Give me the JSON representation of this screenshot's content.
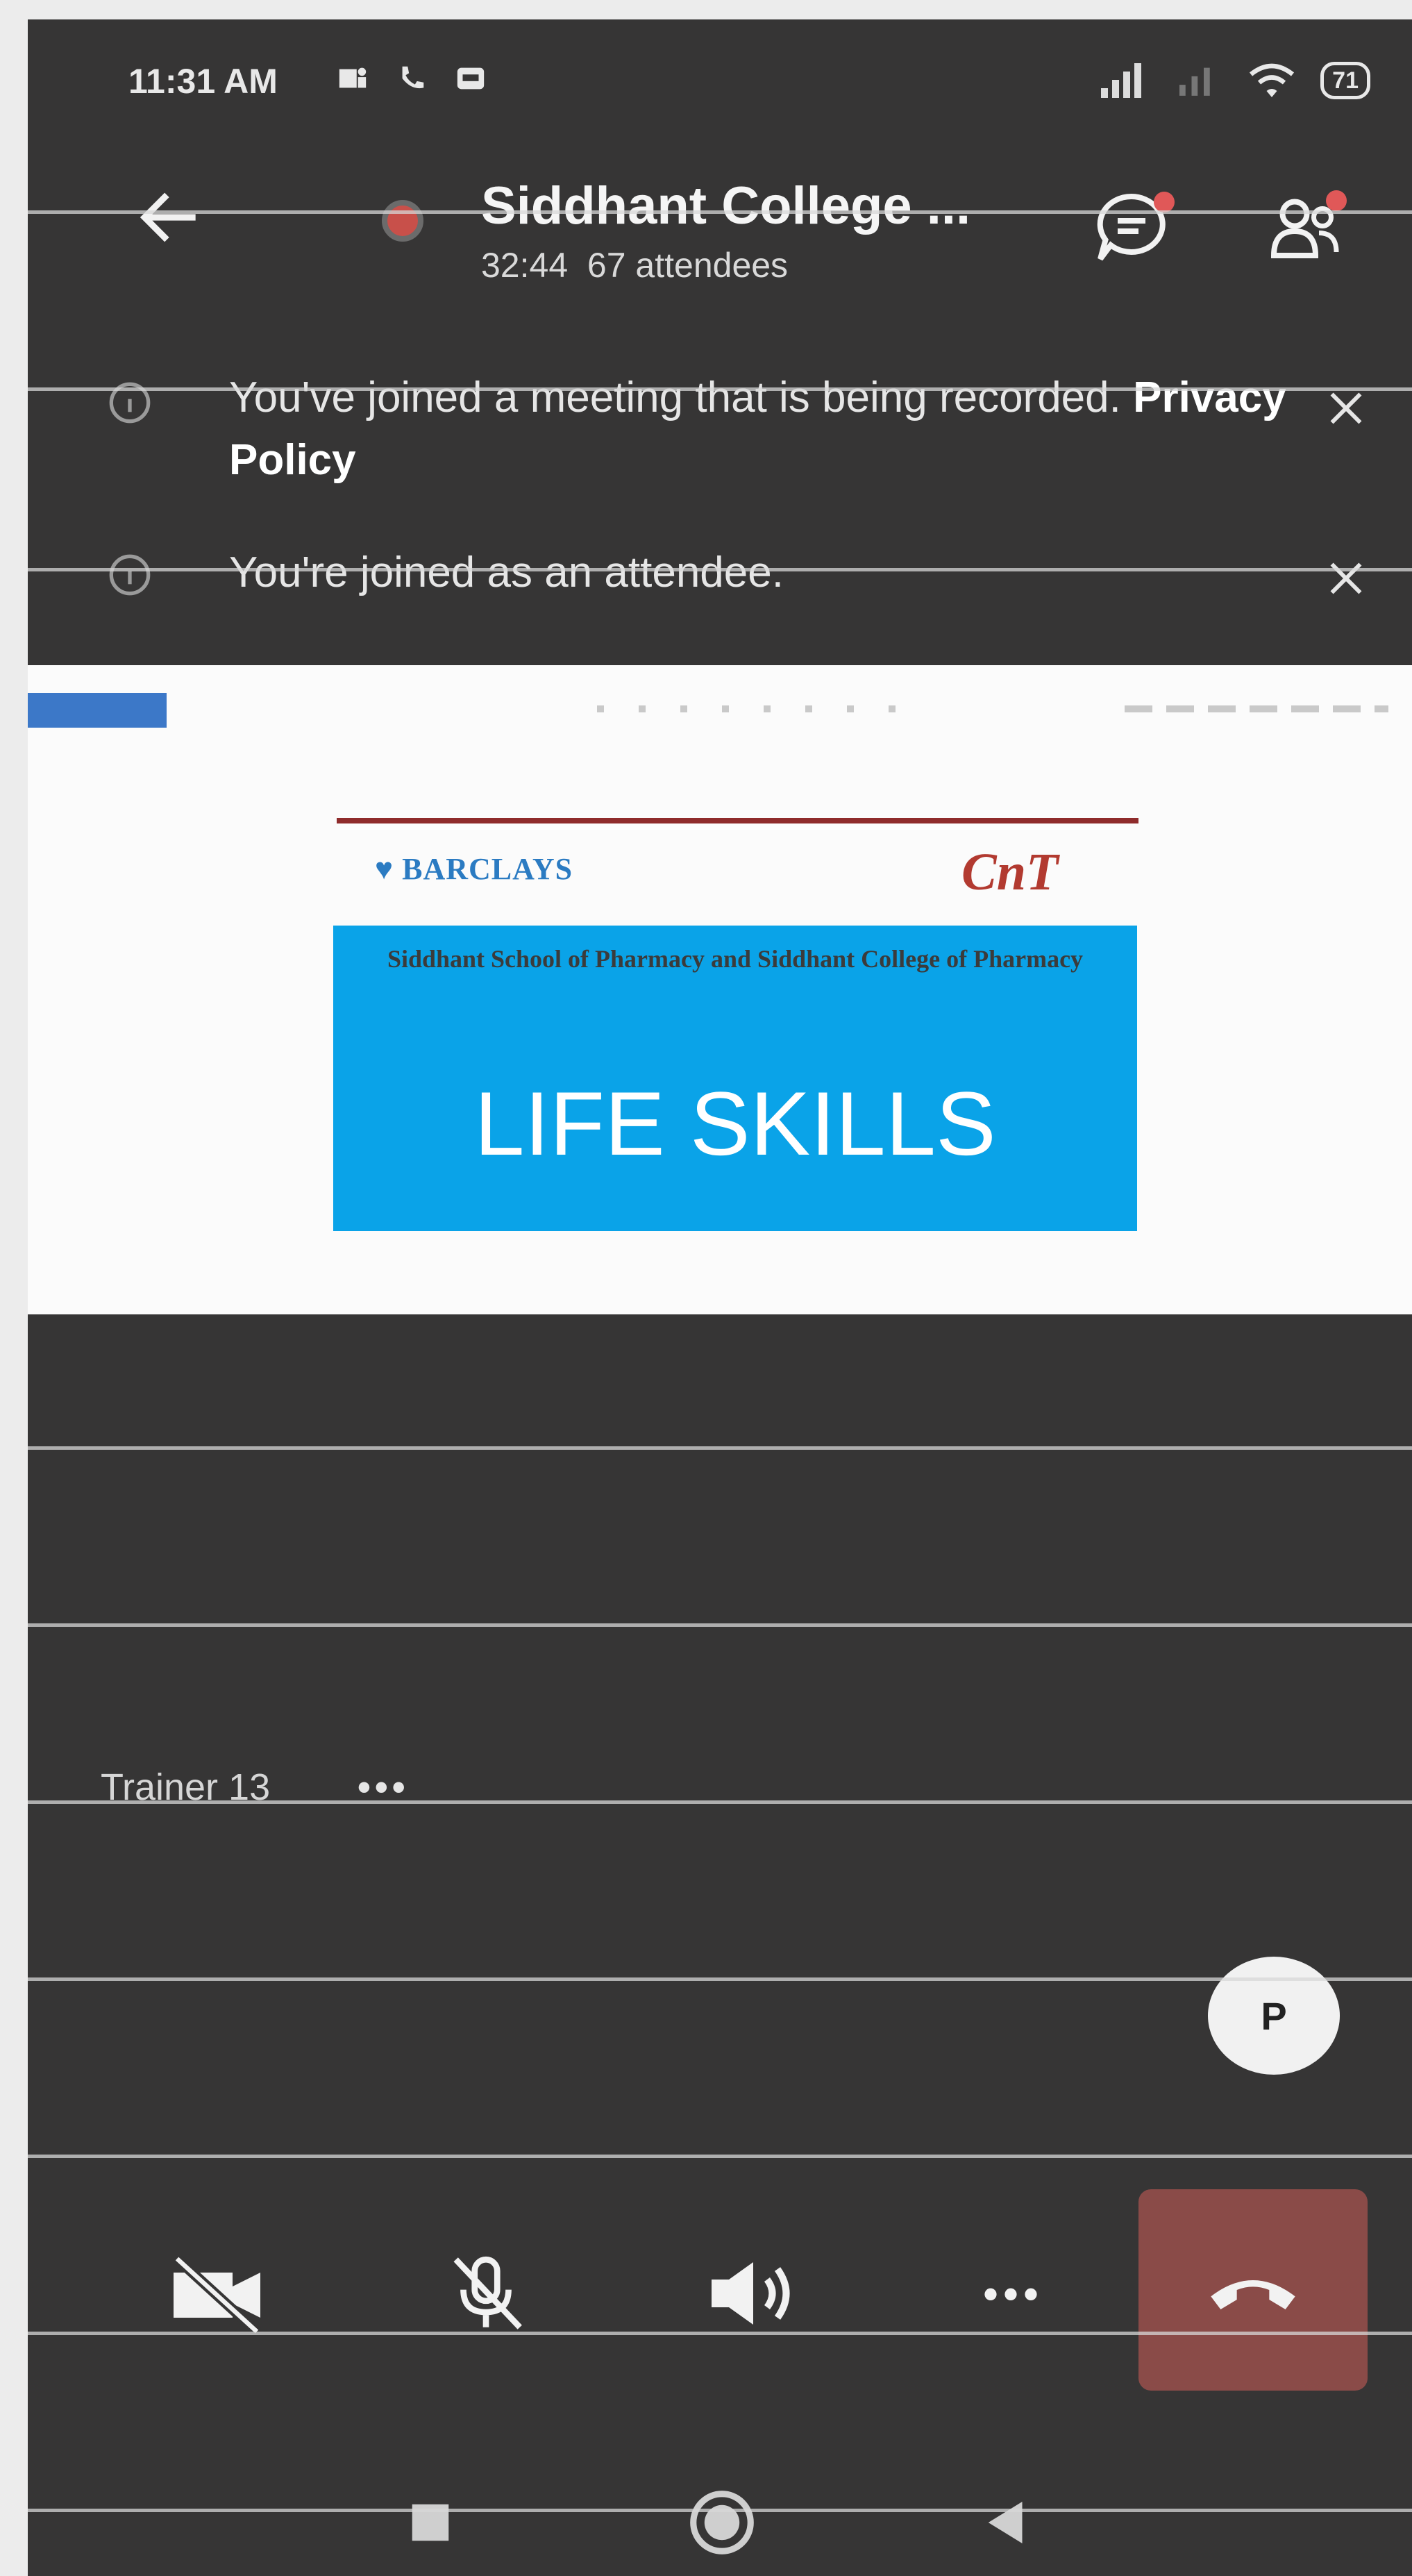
{
  "status_bar": {
    "time": "11:31 AM",
    "battery": "71"
  },
  "header": {
    "title": "Siddhant College ...",
    "duration": "32:44",
    "attendees": "67 attendees"
  },
  "notifications": [
    {
      "text": "You've joined a meeting that is being recorded.",
      "link": "Privacy Policy"
    },
    {
      "text": "You're joined as an attendee."
    }
  ],
  "shared_slide": {
    "sponsor_logo_text": "BARCLAYS",
    "partner_logo_text": "CnT",
    "institution": "Siddhant School of Pharmacy and Siddhant College of Pharmacy",
    "heading": "LIFE SKILLS"
  },
  "presenter": {
    "name": "Trainer 13",
    "more_label": "•••"
  },
  "participant_badge": "P",
  "controls": {
    "more_label": "•••"
  },
  "icons": {
    "back": "back-arrow-icon",
    "recording": "recording-dot-icon",
    "chat": "chat-icon",
    "participants": "participants-icon",
    "info": "info-icon",
    "close": "close-icon",
    "camera_off": "camera-off-icon",
    "mic_off": "mic-off-icon",
    "speaker": "speaker-icon",
    "hangup": "hangup-icon"
  },
  "colors": {
    "background": "#363535",
    "recording": "#c8504a",
    "hangup": "#8a4b48",
    "slide_blue": "#0aa3e8"
  }
}
